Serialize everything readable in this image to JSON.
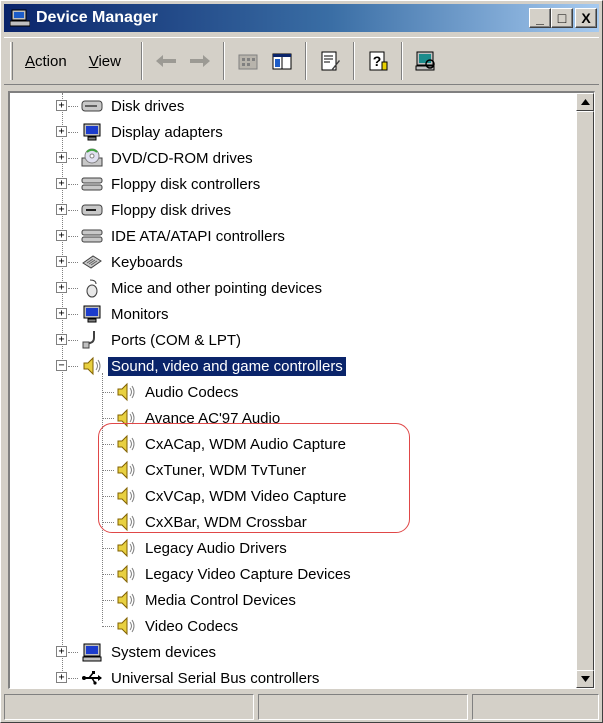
{
  "window": {
    "title": "Device Manager",
    "buttons": {
      "minimize": "_",
      "maximize": "□",
      "close": "X"
    }
  },
  "menu": {
    "action": {
      "accel": "A",
      "rest": "ction"
    },
    "view": {
      "accel": "V",
      "rest": "iew"
    }
  },
  "toolbar": {
    "buttons": [
      "back-icon",
      "forward-icon",
      "up-folder-icon",
      "show-hide-tree-icon",
      "properties-icon",
      "help-icon",
      "scan-hardware-icon"
    ]
  },
  "tree": {
    "categories": [
      {
        "label": "Disk drives",
        "icon": "disk-drive-icon"
      },
      {
        "label": "Display adapters",
        "icon": "monitor-icon"
      },
      {
        "label": "DVD/CD-ROM drives",
        "icon": "cdrom-icon"
      },
      {
        "label": "Floppy disk controllers",
        "icon": "controller-icon"
      },
      {
        "label": "Floppy disk drives",
        "icon": "floppy-icon"
      },
      {
        "label": "IDE ATA/ATAPI controllers",
        "icon": "controller-icon"
      },
      {
        "label": "Keyboards",
        "icon": "keyboard-icon"
      },
      {
        "label": "Mice and other pointing devices",
        "icon": "mouse-icon"
      },
      {
        "label": "Monitors",
        "icon": "monitor-icon"
      },
      {
        "label": "Ports (COM & LPT)",
        "icon": "port-icon"
      },
      {
        "label": "Sound, video and game controllers",
        "icon": "speaker-icon",
        "expanded": true,
        "selected": true
      }
    ],
    "sound_children": [
      "Audio Codecs",
      "Avance AC'97 Audio",
      "CxACap, WDM Audio Capture",
      "CxTuner, WDM TvTuner",
      "CxVCap, WDM Video Capture",
      "CxXBar, WDM Crossbar",
      "Legacy Audio Drivers",
      "Legacy Video Capture Devices",
      "Media Control Devices",
      "Video Codecs"
    ],
    "after": [
      {
        "label": "System devices",
        "icon": "computer-icon"
      },
      {
        "label": "Universal Serial Bus controllers",
        "icon": "usb-icon"
      }
    ]
  },
  "colors": {
    "selection": "#0a246a",
    "highlight_outline": "#e04848"
  }
}
